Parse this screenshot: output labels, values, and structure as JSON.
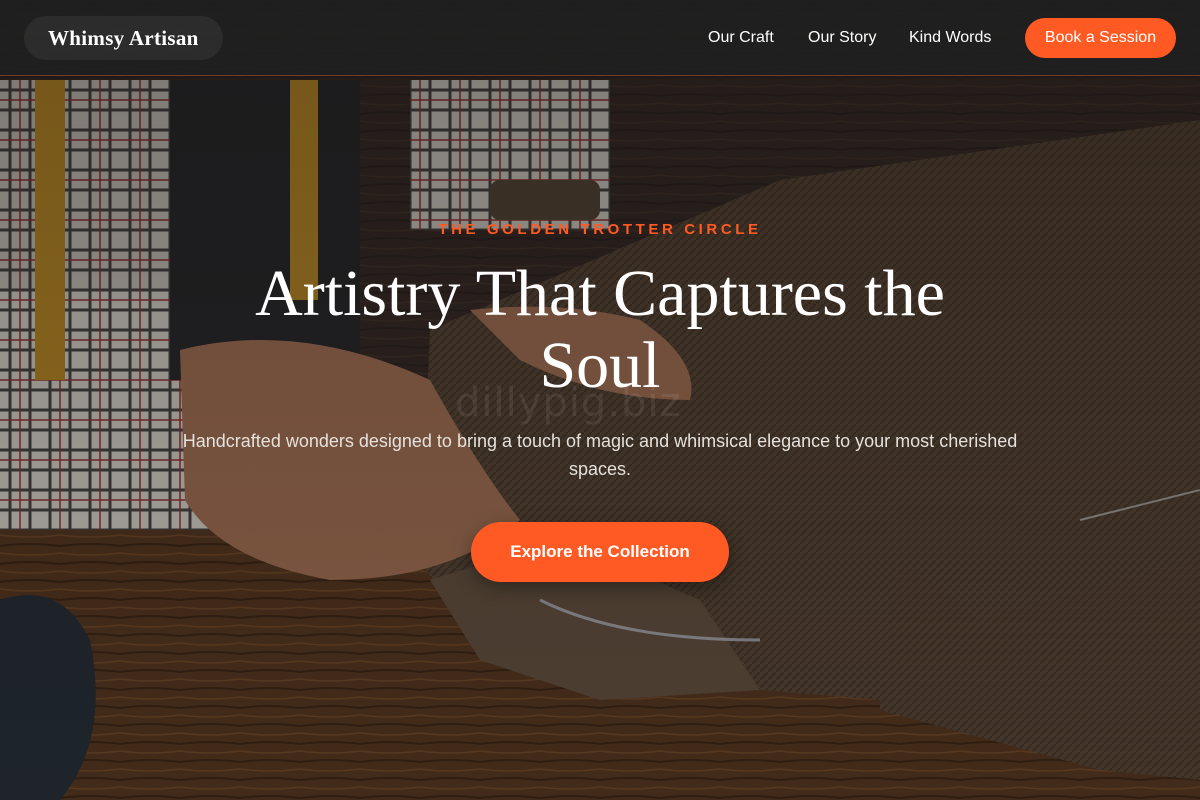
{
  "header": {
    "brand": "Whimsy Artisan",
    "nav": [
      {
        "label": "Our Craft"
      },
      {
        "label": "Our Story"
      },
      {
        "label": "Kind Words"
      }
    ],
    "cta_label": "Book a Session"
  },
  "hero": {
    "eyebrow": "THE GOLDEN TROTTER CIRCLE",
    "headline": "Artistry That Captures the Soul",
    "subtext": "Handcrafted wonders designed to bring a touch of magic and whimsical elegance to your most cherished spaces.",
    "cta_label": "Explore the Collection",
    "background_image": "tailor cutting tweed fabric on a wooden workbench",
    "watermark": "dillypig.biz"
  },
  "colors": {
    "accent": "#ff5a23",
    "navbar_bg": "#202020",
    "text": "#ffffff",
    "subtext": "#e6e1dc"
  }
}
